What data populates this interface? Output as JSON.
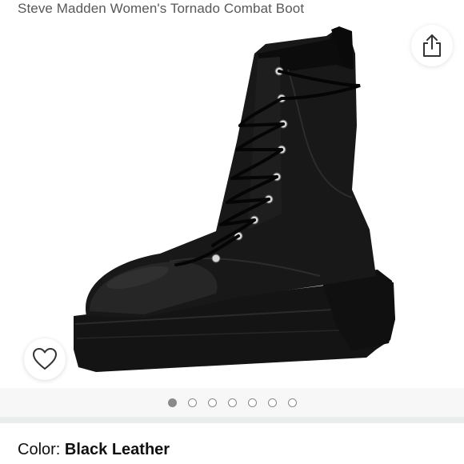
{
  "product": {
    "title": "Steve Madden Women's Tornado Combat Boot"
  },
  "gallery": {
    "image_alt": "Black leather lace-up combat boot",
    "share_icon": "share-icon",
    "wishlist_icon": "heart-icon",
    "dot_count": 7,
    "active_dot": 1
  },
  "variation": {
    "color_label": "Color:",
    "color_value": "Black Leather"
  }
}
